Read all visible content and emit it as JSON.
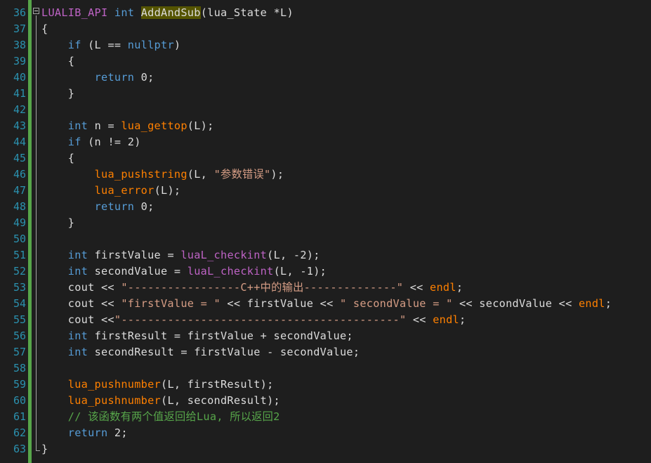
{
  "editor": {
    "language": "C++",
    "first_line": 36,
    "colors": {
      "background": "#1e1e1e",
      "line_number": "#2b91af",
      "keyword": "#569cd6",
      "macro": "#be63c5",
      "function": "#ff8000",
      "string": "#d69d85",
      "comment": "#57a64a",
      "text": "#dcdcdc",
      "change_bar": "#57a64a"
    },
    "lines": [
      {
        "num": "36",
        "tokens": [
          [
            "macro",
            "LUALIB_API"
          ],
          [
            "t",
            " "
          ],
          [
            "kw",
            "int"
          ],
          [
            "t",
            " "
          ],
          [
            "hl",
            "AddAndSub"
          ],
          [
            "t",
            "(lua_State *L)"
          ]
        ]
      },
      {
        "num": "37",
        "tokens": [
          [
            "t",
            "{"
          ]
        ]
      },
      {
        "num": "38",
        "tokens": [
          [
            "t",
            "    "
          ],
          [
            "kw",
            "if"
          ],
          [
            "t",
            " (L == "
          ],
          [
            "kw",
            "nullptr"
          ],
          [
            "t",
            ")"
          ]
        ]
      },
      {
        "num": "39",
        "tokens": [
          [
            "t",
            "    {"
          ]
        ]
      },
      {
        "num": "40",
        "tokens": [
          [
            "t",
            "        "
          ],
          [
            "kw",
            "return"
          ],
          [
            "t",
            " 0;"
          ]
        ]
      },
      {
        "num": "41",
        "tokens": [
          [
            "t",
            "    }"
          ]
        ]
      },
      {
        "num": "42",
        "tokens": []
      },
      {
        "num": "43",
        "tokens": [
          [
            "t",
            "    "
          ],
          [
            "kw",
            "int"
          ],
          [
            "t",
            " n = "
          ],
          [
            "fn",
            "lua_gettop"
          ],
          [
            "t",
            "(L);"
          ]
        ]
      },
      {
        "num": "44",
        "tokens": [
          [
            "t",
            "    "
          ],
          [
            "kw",
            "if"
          ],
          [
            "t",
            " (n != 2)"
          ]
        ]
      },
      {
        "num": "45",
        "tokens": [
          [
            "t",
            "    {"
          ]
        ]
      },
      {
        "num": "46",
        "tokens": [
          [
            "t",
            "        "
          ],
          [
            "fn",
            "lua_pushstring"
          ],
          [
            "t",
            "(L, "
          ],
          [
            "str",
            "\"参数错误\""
          ],
          [
            "t",
            ");"
          ]
        ]
      },
      {
        "num": "47",
        "tokens": [
          [
            "t",
            "        "
          ],
          [
            "fn",
            "lua_error"
          ],
          [
            "t",
            "(L);"
          ]
        ]
      },
      {
        "num": "48",
        "tokens": [
          [
            "t",
            "        "
          ],
          [
            "kw",
            "return"
          ],
          [
            "t",
            " 0;"
          ]
        ]
      },
      {
        "num": "49",
        "tokens": [
          [
            "t",
            "    }"
          ]
        ]
      },
      {
        "num": "50",
        "tokens": []
      },
      {
        "num": "51",
        "tokens": [
          [
            "t",
            "    "
          ],
          [
            "kw",
            "int"
          ],
          [
            "t",
            " firstValue = "
          ],
          [
            "macro",
            "luaL_checkint"
          ],
          [
            "t",
            "(L, -2);"
          ]
        ]
      },
      {
        "num": "52",
        "tokens": [
          [
            "t",
            "    "
          ],
          [
            "kw",
            "int"
          ],
          [
            "t",
            " secondValue = "
          ],
          [
            "macro",
            "luaL_checkint"
          ],
          [
            "t",
            "(L, -1);"
          ]
        ]
      },
      {
        "num": "53",
        "tokens": [
          [
            "t",
            "    cout << "
          ],
          [
            "str",
            "\"-----------------C++中的输出--------------\""
          ],
          [
            "t",
            " << "
          ],
          [
            "fn",
            "endl"
          ],
          [
            "t",
            ";"
          ]
        ]
      },
      {
        "num": "54",
        "tokens": [
          [
            "t",
            "    cout << "
          ],
          [
            "str",
            "\"firstValue = \""
          ],
          [
            "t",
            " << firstValue << "
          ],
          [
            "str",
            "\" secondValue = \""
          ],
          [
            "t",
            " << secondValue << "
          ],
          [
            "fn",
            "endl"
          ],
          [
            "t",
            ";"
          ]
        ]
      },
      {
        "num": "55",
        "tokens": [
          [
            "t",
            "    cout <<"
          ],
          [
            "str",
            "\"------------------------------------------\""
          ],
          [
            "t",
            " << "
          ],
          [
            "fn",
            "endl"
          ],
          [
            "t",
            ";"
          ]
        ]
      },
      {
        "num": "56",
        "tokens": [
          [
            "t",
            "    "
          ],
          [
            "kw",
            "int"
          ],
          [
            "t",
            " firstResult = firstValue + secondValue;"
          ]
        ]
      },
      {
        "num": "57",
        "tokens": [
          [
            "t",
            "    "
          ],
          [
            "kw",
            "int"
          ],
          [
            "t",
            " secondResult = firstValue - secondValue;"
          ]
        ]
      },
      {
        "num": "58",
        "tokens": []
      },
      {
        "num": "59",
        "tokens": [
          [
            "t",
            "    "
          ],
          [
            "fn",
            "lua_pushnumber"
          ],
          [
            "t",
            "(L, firstResult);"
          ]
        ]
      },
      {
        "num": "60",
        "tokens": [
          [
            "t",
            "    "
          ],
          [
            "fn",
            "lua_pushnumber"
          ],
          [
            "t",
            "(L, secondResult);"
          ]
        ]
      },
      {
        "num": "61",
        "tokens": [
          [
            "t",
            "    "
          ],
          [
            "cm",
            "// 该函数有两个值返回给Lua, 所以返回2"
          ]
        ]
      },
      {
        "num": "62",
        "tokens": [
          [
            "t",
            "    "
          ],
          [
            "kw",
            "return"
          ],
          [
            "t",
            " 2;"
          ]
        ]
      },
      {
        "num": "63",
        "tokens": [
          [
            "t",
            "}"
          ]
        ]
      }
    ]
  }
}
